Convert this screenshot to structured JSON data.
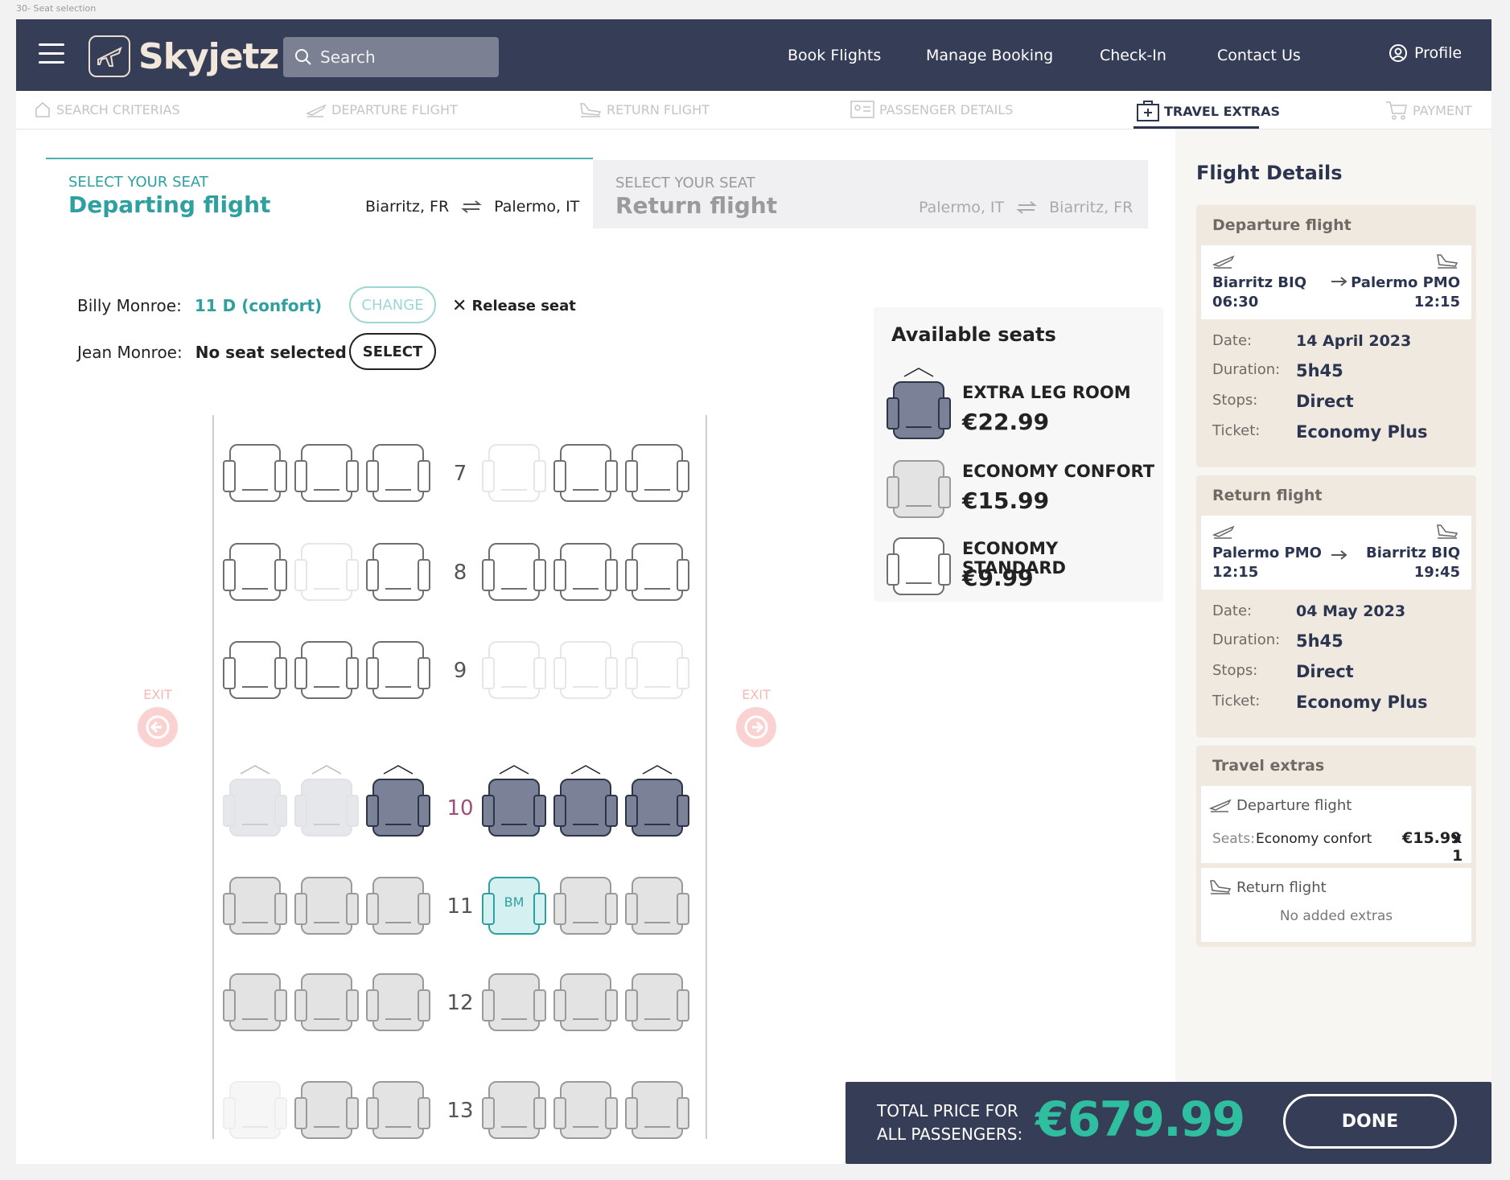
{
  "frame_label": "30- Seat selection",
  "brand": {
    "name": "Skyjetz"
  },
  "search": {
    "placeholder": "Search"
  },
  "nav": {
    "book": "Book Flights",
    "manage": "Manage Booking",
    "checkin": "Check-In",
    "contact": "Contact Us",
    "profile": "Profile"
  },
  "steps": {
    "search": "SEARCH CRITERIAS",
    "departure": "DEPARTURE FLIGHT",
    "return": "RETURN FLIGHT",
    "passengers": "PASSENGER DETAILS",
    "extras": "TRAVEL EXTRAS",
    "payment": "PAYMENT",
    "active": "extras"
  },
  "tabs": {
    "departing": {
      "small": "SELECT YOUR SEAT",
      "big": "Departing flight",
      "from": "Biarritz, FR",
      "to": "Palermo, IT"
    },
    "returning": {
      "small": "SELECT YOUR SEAT",
      "big": "Return flight",
      "from": "Palermo, IT",
      "to": "Biarritz, FR"
    }
  },
  "passengers": [
    {
      "name": "Billy Monroe:",
      "seat": "11 D (confort)",
      "action": "CHANGE",
      "release": "Release seat"
    },
    {
      "name": "Jean Monroe:",
      "seat": "No seat selected",
      "action": "SELECT"
    }
  ],
  "exit_label": "EXIT",
  "seat_map": {
    "rows": [
      {
        "num": "7",
        "seats": [
          "std",
          "std",
          "std",
          "std-off",
          "std",
          "std"
        ]
      },
      {
        "num": "8",
        "seats": [
          "std",
          "std-off",
          "std",
          "std",
          "std",
          "std"
        ]
      },
      {
        "num": "9",
        "seats": [
          "std",
          "std",
          "std",
          "std-off",
          "std-off",
          "std-off"
        ]
      },
      {
        "num": "10",
        "seats": [
          "xl-off",
          "xl-off",
          "xl",
          "xl",
          "xl",
          "xl"
        ]
      },
      {
        "num": "11",
        "seats": [
          "conf",
          "conf",
          "conf",
          "sel",
          "conf",
          "conf"
        ]
      },
      {
        "num": "12",
        "seats": [
          "conf",
          "conf",
          "conf",
          "conf",
          "conf",
          "conf"
        ]
      },
      {
        "num": "13",
        "seats": [
          "conf-off",
          "conf",
          "conf",
          "conf",
          "conf",
          "conf"
        ]
      }
    ],
    "selected_initials": "BM"
  },
  "available": {
    "title": "Available seats",
    "items": [
      {
        "name": "EXTRA LEG ROOM",
        "price": "€22.99",
        "type": "xl"
      },
      {
        "name": "ECONOMY CONFORT",
        "price": "€15.99",
        "type": "conf"
      },
      {
        "name": "ECONOMY STANDARD",
        "price": "€9.99",
        "type": "std"
      }
    ]
  },
  "flight_details": {
    "title": "Flight Details",
    "departure": {
      "heading": "Departure flight",
      "from": "Biarritz BIQ",
      "from_time": "06:30",
      "to": "Palermo PMO",
      "to_time": "12:15",
      "date_k": "Date:",
      "date": "14 April 2023",
      "duration_k": "Duration:",
      "duration": "5h45",
      "stops_k": "Stops:",
      "stops": "Direct",
      "ticket_k": "Ticket:",
      "ticket": "Economy Plus"
    },
    "return": {
      "heading": "Return flight",
      "from": "Palermo PMO",
      "from_time": "12:15",
      "to": "Biarritz BIQ",
      "to_time": "19:45",
      "date_k": "Date:",
      "date": "04 May 2023",
      "duration_k": "Duration:",
      "duration": "5h45",
      "stops_k": "Stops:",
      "stops": "Direct",
      "ticket_k": "Ticket:",
      "ticket": "Economy Plus"
    },
    "extras": {
      "heading": "Travel extras",
      "dep_label": "Departure flight",
      "seats_k": "Seats:",
      "seats_v": "Economy confort",
      "seats_price": "€15.99",
      "seats_qty": "x 1",
      "ret_label": "Return flight",
      "ret_none": "No added extras"
    }
  },
  "total": {
    "label_line1": "TOTAL PRICE FOR",
    "label_line2": "ALL PASSENGERS:",
    "price": "€679.99",
    "done": "DONE"
  },
  "colors": {
    "navy": "#363d56",
    "teal": "#2fa0a0",
    "green": "#2fbe9f",
    "exit": "#fbd2d2"
  }
}
